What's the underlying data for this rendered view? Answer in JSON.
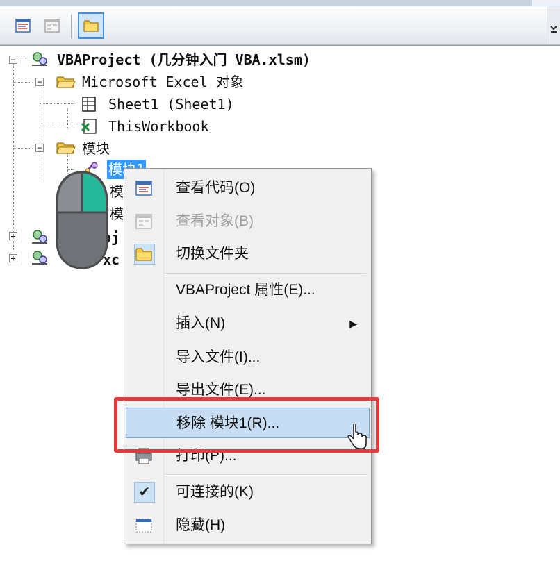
{
  "toolbar": {
    "buttons": [
      {
        "name": "view-code",
        "icon": "code-window-icon",
        "active": false
      },
      {
        "name": "view-object",
        "icon": "object-window-icon",
        "active": false
      },
      {
        "name": "toggle-folders",
        "icon": "folder-icon",
        "active": true
      }
    ]
  },
  "tree": {
    "project": "VBAProject (几分钟入门 VBA.xlsm)",
    "excel_objects": "Microsoft Excel 对象",
    "sheet1": "Sheet1 (Sheet1)",
    "thisworkbook": "ThisWorkbook",
    "modules_folder": "模块",
    "module1": "模块1",
    "module2": "模",
    "module3": "模",
    "project2": "oj",
    "project3": "xc"
  },
  "context_menu": {
    "view_code": "查看代码(O)",
    "view_object": "查看对象(B)",
    "toggle_folders": "切换文件夹",
    "properties": "VBAProject 属性(E)...",
    "insert": "插入(N)",
    "import_file": "导入文件(I)...",
    "export_file": "导出文件(E)...",
    "remove_module": "移除 模块1(R)...",
    "print": "打印(P)...",
    "dockable": "可连接的(K)",
    "hide": "隐藏(H)"
  },
  "colors": {
    "highlight_border": "#e23c3c",
    "selection": "#3399ff",
    "hot_item": "#c7ddf3",
    "mouse_accent": "#25b89a"
  }
}
